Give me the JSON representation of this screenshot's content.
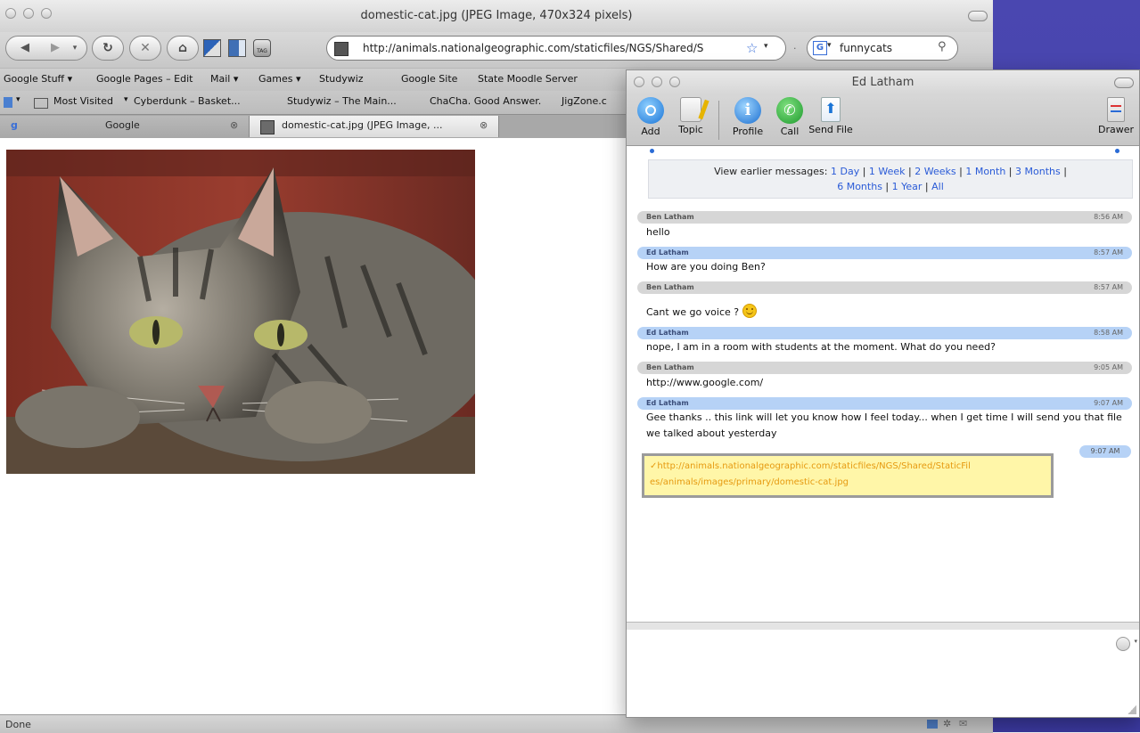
{
  "browser": {
    "window_title": "domestic-cat.jpg (JPEG Image, 470x324 pixels)",
    "url": "http://animals.nationalgeographic.com/staticfiles/NGS/Shared/S",
    "search_value": "funnycats",
    "bookmarks_row1": [
      "Google Stuff ▾",
      "Google Pages – Edit",
      "Mail ▾",
      "Games ▾",
      "Studywiz",
      "Google Site",
      "State Moodle Server"
    ],
    "bookmarks_row2": [
      "▾",
      "Most Visited",
      "▾",
      "Cyberdunk – Basket...",
      "Studywiz – The Main...",
      "ChaCha. Good Answer.",
      "JigZone.c"
    ],
    "tabs": [
      {
        "label": "Google"
      },
      {
        "label": "domestic-cat.jpg (JPEG Image, ..."
      }
    ],
    "status": "Done"
  },
  "chat": {
    "title": "Ed Latham",
    "tools": {
      "add": "Add",
      "topic": "Topic",
      "profile": "Profile",
      "call": "Call",
      "send_file": "Send File",
      "drawer": "Drawer"
    },
    "earlier": {
      "prefix": "View earlier messages:",
      "options": [
        "1 Day",
        "1 Week",
        "2 Weeks",
        "1 Month",
        "3 Months",
        "6 Months",
        "1 Year",
        "All"
      ]
    },
    "messages": [
      {
        "sender": "Ben Latham",
        "time": "8:56 AM",
        "text": "hello"
      },
      {
        "sender": "Ed Latham",
        "time": "8:57 AM",
        "text": "How are you doing Ben?"
      },
      {
        "sender": "Ben Latham",
        "time": "8:57 AM",
        "text": "Cant we go voice ?"
      },
      {
        "sender": "Ed Latham",
        "time": "8:58 AM",
        "text": "nope, I am in a room with students at the moment. What do you need?"
      },
      {
        "sender": "Ben Latham",
        "time": "9:05 AM",
        "text": "http://www.google.com/"
      },
      {
        "sender": "Ed Latham",
        "time": "9:07 AM",
        "text": "Gee thanks .. this link will let you know how I feel today... when I get time I will send you that file we talked about yesterday"
      }
    ],
    "pending": {
      "time": "9:07 AM",
      "text_line1": "✓http://animals.nationalgeographic.com/staticfiles/NGS/Shared/StaticFil",
      "text_line2": "es/animals/images/primary/domestic-cat.jpg"
    }
  }
}
